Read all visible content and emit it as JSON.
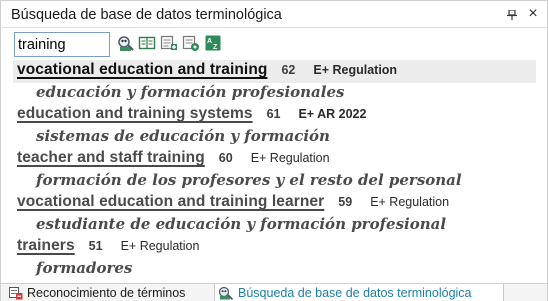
{
  "window": {
    "title": "Búsqueda de base de datos terminológica",
    "pin_icon": "pin-icon",
    "close_icon": "close-icon"
  },
  "toolbar": {
    "search_value": "training",
    "icons": [
      "search-settings-icon",
      "termbase-view-icon",
      "add-term-icon",
      "termbase-settings-icon",
      "az-sort-icon"
    ]
  },
  "results": [
    {
      "term": "vocational education and training",
      "score": "62",
      "source": "E+ Regulation",
      "translation": "educación y formación profesionales",
      "selected": true
    },
    {
      "term": "education and training systems",
      "score": "61",
      "source": "E+ AR 2022",
      "translation": "sistemas de educación y formación",
      "selected": false
    },
    {
      "term": "teacher and staff training",
      "score": "60",
      "source": "E+ Regulation",
      "translation": "formación de los profesores y el resto del personal",
      "selected": false
    },
    {
      "term": "vocational education and training learner",
      "score": "59",
      "source": "E+ Regulation",
      "translation": "estudiante de educación y formación profesional",
      "selected": false
    },
    {
      "term": "trainers",
      "score": "51",
      "source": "E+ Regulation",
      "translation": "formadores",
      "selected": false
    }
  ],
  "tabs": [
    {
      "label": "Reconocimiento de términos",
      "active": false
    },
    {
      "label": "Búsqueda de base de datos terminológica",
      "active": true
    }
  ],
  "colors": {
    "accent": "#1c7fa8",
    "selected_row": "#ececec",
    "term_text": "#4a4a4a"
  }
}
